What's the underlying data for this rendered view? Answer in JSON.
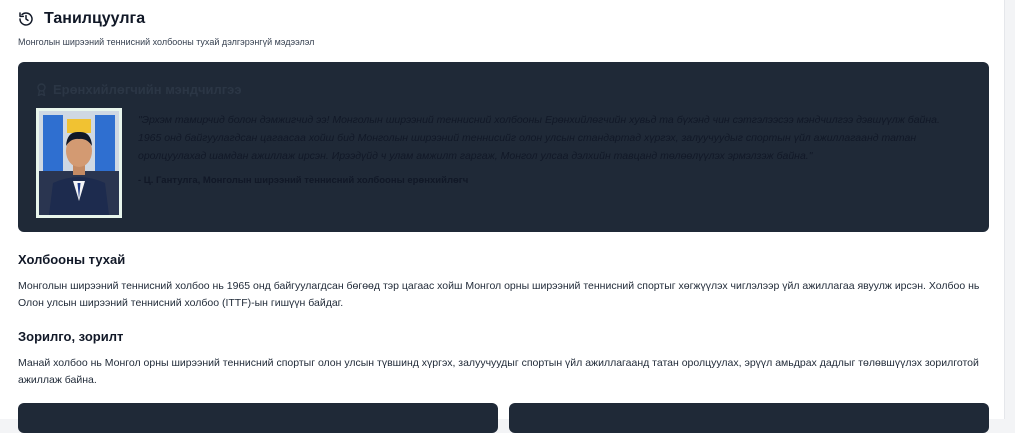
{
  "header": {
    "icon": "history-icon",
    "title": "Танилцуулга",
    "subtitle": "Монголын ширээний теннисний холбооны тухай дэлгэрэнгүй мэдээлэл"
  },
  "president": {
    "heading_icon": "award-icon",
    "heading": "Ерөнхийлөгчийн мэндчилгээ",
    "quote": "\"Эрхэм тамирчид болон дэмжигчид ээ! Монголын ширээний теннисний холбооны Ерөнхийлөгчийн хувьд та бүхэнд чин сэтгэлээсээ мэндчилгээ дэвшүүлж байна. 1965 онд байгуулагдсан цагаасаа хойш бид Монголын ширээний теннисийг олон улсын стандартад хүргэх, залуучуудыг спортын үйл ажиллагаанд татан оролцуулахад шамдан ажиллаж ирсэн. Ирээдүйд ч улам амжилт гаргаж, Монгол улсаа дэлхийн тавцанд төлөөлүүлэх эрмэлзэж байна.\"",
    "author": "- Ц. Гантулга, Монголын ширээний теннисний холбооны ерөнхийлөгч"
  },
  "about": {
    "title": "Холбооны тухай",
    "text": "Монголын ширээний теннисний холбоо нь 1965 онд байгуулагдсан бөгөөд тэр цагаас хойш Монгол орны ширээний теннисний спортыг хөгжүүлэх чиглэлээр үйл ажиллагаа явуулж ирсэн. Холбоо нь Олон улсын ширээний теннисний холбоо (ITTF)-ын гишүүн байдаг."
  },
  "goals": {
    "title": "Зорилго, зорилт",
    "text": "Манай холбоо нь Монгол орны ширээний теннисний спортыг олон улсын түвшинд хүргэх, залуучуудыг спортын үйл ажиллагаанд татан оролцуулах, эрүүл амьдрах дадлыг төлөвшүүлэх зорилготой ажиллаж байна."
  },
  "colors": {
    "panel_bg": "#1f2937",
    "frame_green": "#3aa36b",
    "page_bg": "#ffffff"
  }
}
